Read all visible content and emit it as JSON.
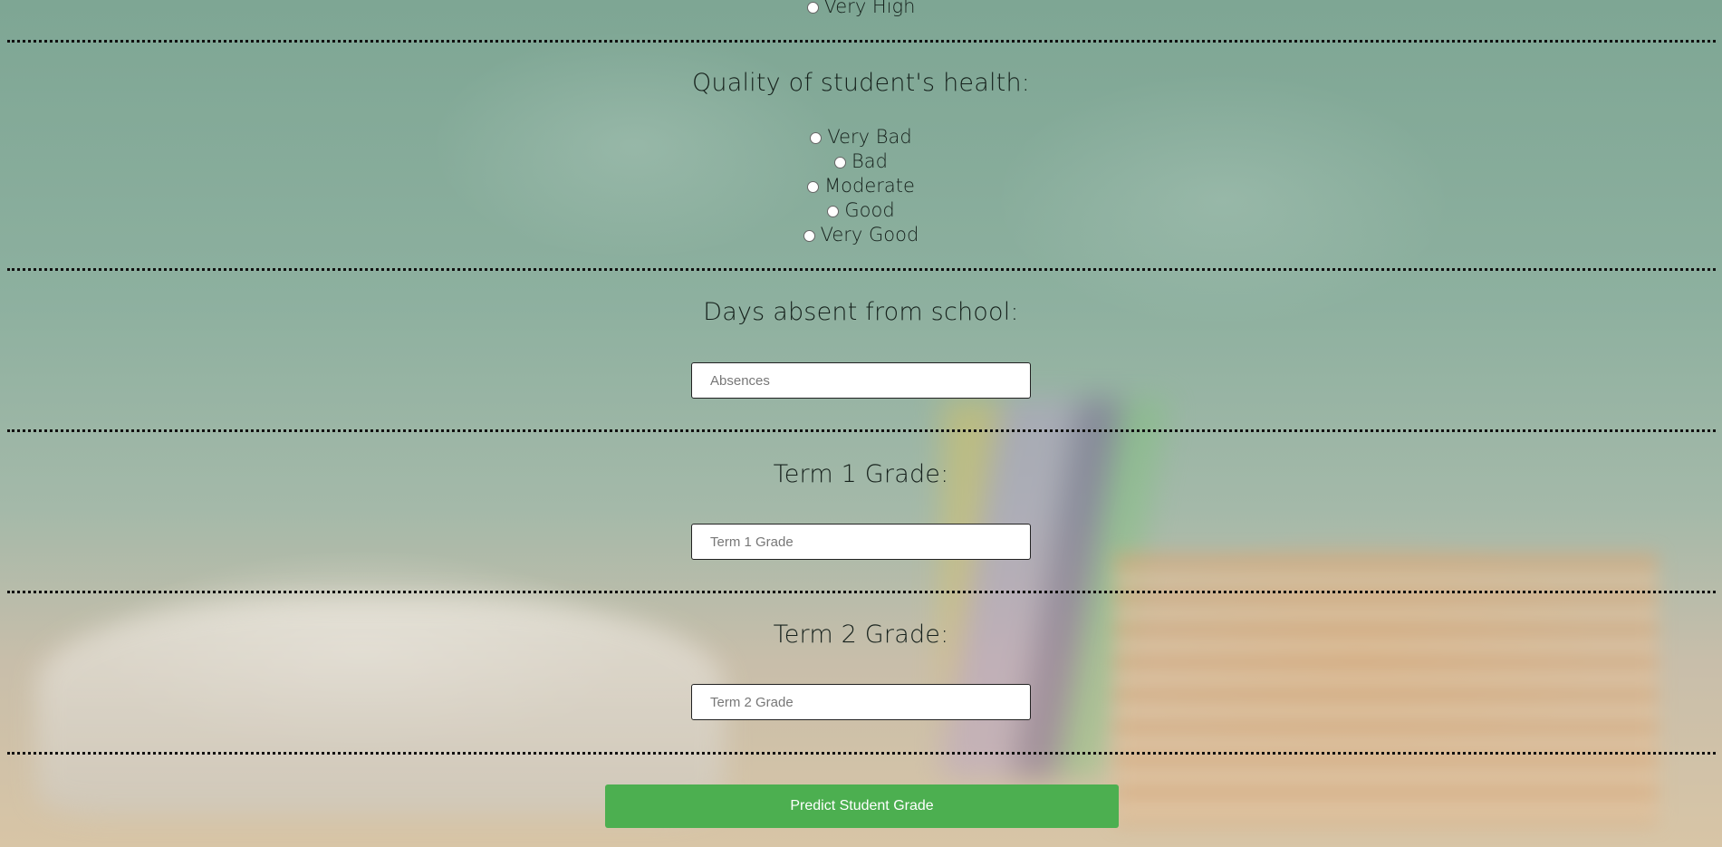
{
  "top_option": {
    "label": "Very High"
  },
  "health": {
    "heading": "Quality of student's health:",
    "options": [
      "Very Bad",
      "Bad",
      "Moderate",
      "Good",
      "Very Good"
    ]
  },
  "absences": {
    "heading": "Days absent from school:",
    "placeholder": "Absences"
  },
  "term1": {
    "heading": "Term 1 Grade:",
    "placeholder": "Term 1 Grade"
  },
  "term2": {
    "heading": "Term 2 Grade:",
    "placeholder": "Term 2 Grade"
  },
  "submit": {
    "label": "Predict Student Grade"
  },
  "colors": {
    "button": "#4caf50",
    "divider": "#111111"
  }
}
